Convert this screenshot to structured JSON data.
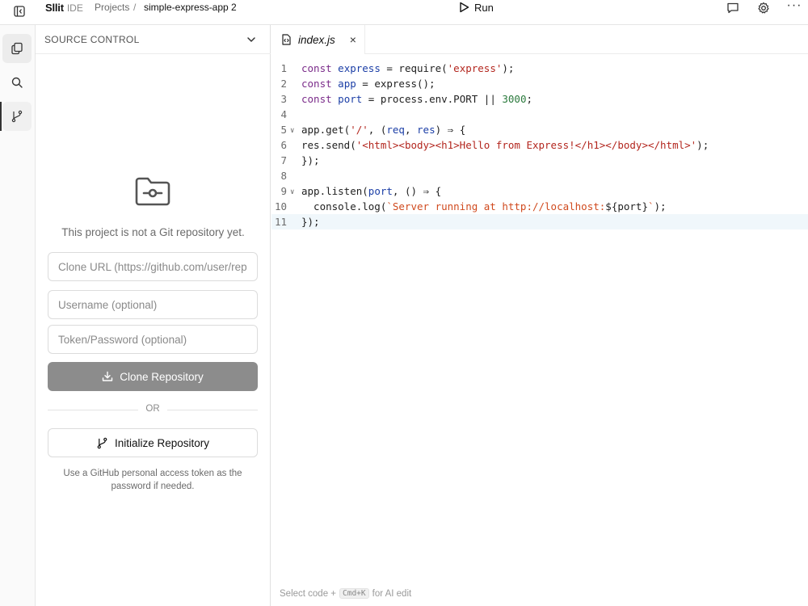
{
  "topbar": {
    "brand_name": "Sllit",
    "brand_sub": "IDE",
    "breadcrumb_projects": "Projects",
    "breadcrumb_sep": "/",
    "project_name": "simple-express-app 2",
    "run_label": "Run",
    "more_label": "···"
  },
  "activity": {
    "items": [
      "files-icon",
      "search-icon",
      "git-branch-icon"
    ],
    "active": "git-branch-icon"
  },
  "sidebar": {
    "title": "SOURCE CONTROL",
    "message": "This project is not a Git repository yet.",
    "clone_url_placeholder": "Clone URL (https://github.com/user/rep",
    "username_placeholder": "Username (optional)",
    "token_placeholder": "Token/Password (optional)",
    "clone_button": "Clone Repository",
    "or_label": "OR",
    "init_button": "Initialize Repository",
    "hint": "Use a GitHub personal access token as the password if needed."
  },
  "editor": {
    "tab_label": "index.js",
    "tab_close": "×",
    "footer_pre": "Select code +",
    "footer_kbd": "Cmd+K",
    "footer_post": "for AI edit",
    "lines": [
      {
        "n": "1",
        "code": "const express = require('express');"
      },
      {
        "n": "2",
        "code": "const app = express();"
      },
      {
        "n": "3",
        "code": "const port = process.env.PORT || 3000;"
      },
      {
        "n": "4",
        "code": ""
      },
      {
        "n": "5",
        "code": "app.get('/', (req, res) ⇒ {"
      },
      {
        "n": "6",
        "code": "res.send('<html><body><h1>Hello from Express!</h1></body></html>');"
      },
      {
        "n": "7",
        "code": "});"
      },
      {
        "n": "8",
        "code": ""
      },
      {
        "n": "9",
        "code": "app.listen(port, () ⇒ {"
      },
      {
        "n": "10",
        "code": "  console.log(`Server running at http://localhost:${port}`);"
      },
      {
        "n": "11",
        "code": "});"
      }
    ]
  },
  "colors": {
    "keyword": "#7b2c8a",
    "identifier": "#1b3ea6",
    "string": "#b3261e",
    "number": "#2b7a3d",
    "template": "#d04a1e",
    "clone_button_bg": "#8c8c8c"
  }
}
